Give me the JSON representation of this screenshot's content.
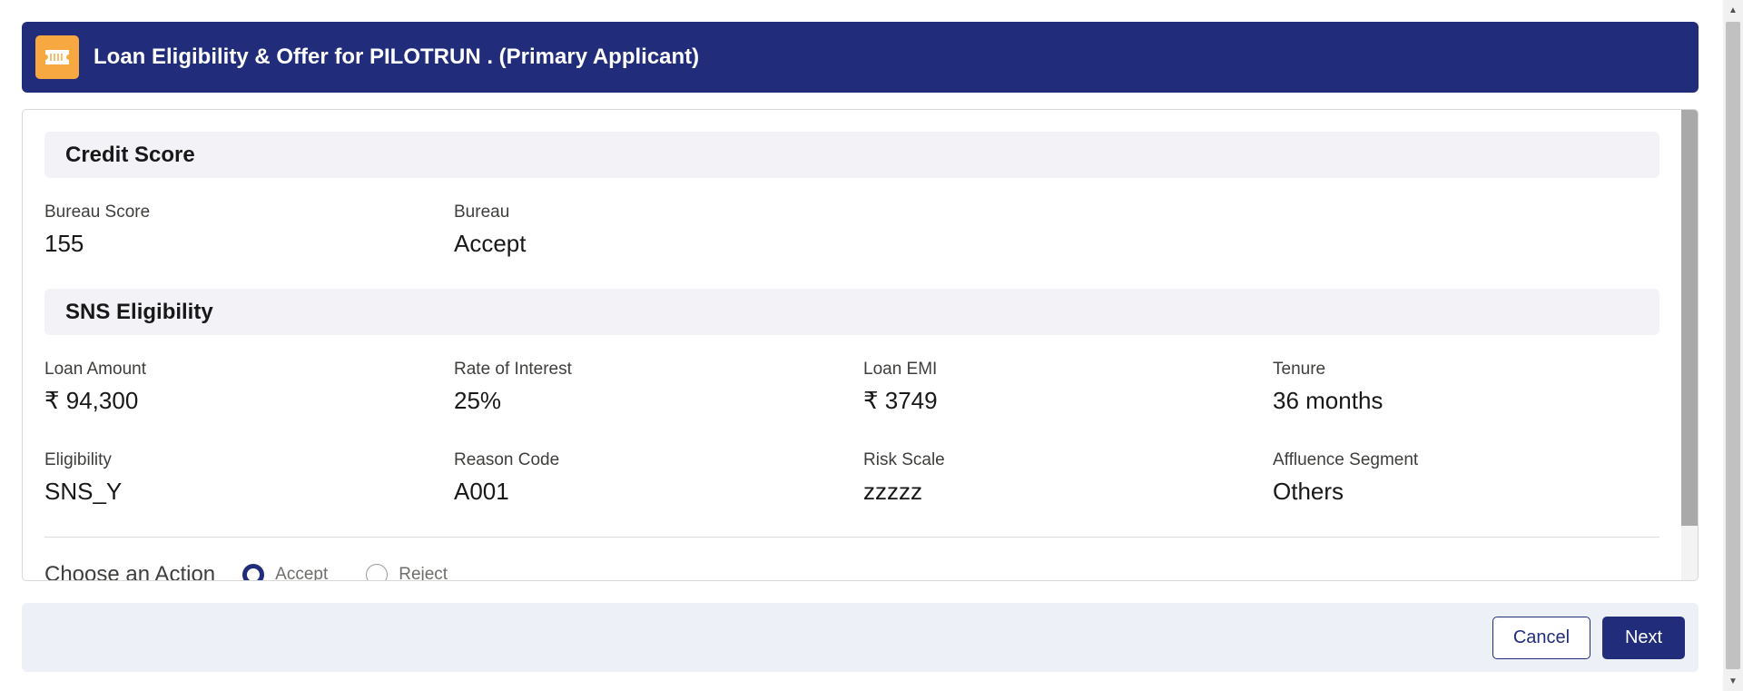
{
  "header": {
    "title": "Loan Eligibility & Offer for PILOTRUN . (Primary Applicant)",
    "icon": "ticket-icon",
    "icon_color": "#f8a841",
    "background": "#212d7a"
  },
  "credit_score": {
    "title": "Credit Score",
    "fields": [
      {
        "label": "Bureau Score",
        "value": "155"
      },
      {
        "label": "Bureau",
        "value": "Accept"
      }
    ]
  },
  "sns_eligibility": {
    "title": "SNS Eligibility",
    "fields": [
      {
        "label": "Loan Amount",
        "value": "₹ 94,300"
      },
      {
        "label": "Rate of Interest",
        "value": "25%"
      },
      {
        "label": "Loan EMI",
        "value": "₹ 3749"
      },
      {
        "label": "Tenure",
        "value": "36 months"
      },
      {
        "label": "Eligibility",
        "value": "SNS_Y"
      },
      {
        "label": "Reason Code",
        "value": "A001"
      },
      {
        "label": "Risk Scale",
        "value": "zzzzz"
      },
      {
        "label": "Affluence Segment",
        "value": "Others"
      }
    ]
  },
  "action": {
    "label": "Choose an Action",
    "options": [
      {
        "label": "Accept",
        "selected": true
      },
      {
        "label": "Reject",
        "selected": false
      }
    ]
  },
  "footer": {
    "cancel_label": "Cancel",
    "next_label": "Next"
  }
}
